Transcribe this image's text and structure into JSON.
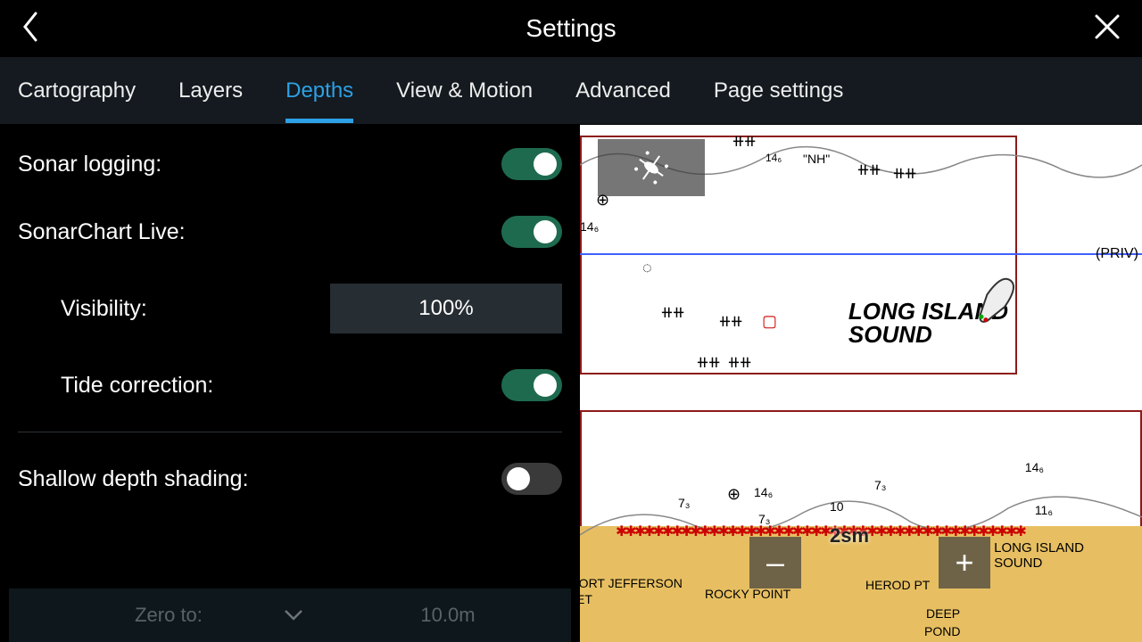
{
  "header": {
    "title": "Settings"
  },
  "tabs": [
    {
      "label": "Cartography",
      "active": false
    },
    {
      "label": "Layers",
      "active": false
    },
    {
      "label": "Depths",
      "active": true
    },
    {
      "label": "View & Motion",
      "active": false
    },
    {
      "label": "Advanced",
      "active": false
    },
    {
      "label": "Page settings",
      "active": false
    }
  ],
  "settings": {
    "sonar_logging_label": "Sonar logging:",
    "sonar_logging_on": true,
    "sonarchart_live_label": "SonarChart Live:",
    "sonarchart_live_on": true,
    "visibility_label": "Visibility:",
    "visibility_value": "100%",
    "tide_correction_label": "Tide correction:",
    "tide_correction_on": true,
    "shallow_depth_label": "Shallow depth shading:",
    "shallow_depth_on": false,
    "zero_to_label": "Zero to:",
    "zero_to_value": "10.0m"
  },
  "chart": {
    "region_label_line1": "LONG ISLAND",
    "region_label_line2": "SOUND",
    "region_label2": "LONG ISLAND",
    "region_label2b": "SOUND",
    "priv_label": "(PRIV)",
    "scale_label": "2sm",
    "place_rocky": "ROCKY POINT",
    "place_herod": "HEROD PT",
    "place_deep": "DEEP",
    "place_pond": "POND",
    "place_jeff1": "'ORT JEFFERSON",
    "place_jeff2": "ET",
    "nh_label": "\"NH\"",
    "depth_146a": "14₆",
    "depth_146b": "14₆",
    "depth_146c": "14₆",
    "depth_146d": "14₆",
    "depth_73a": "7₃",
    "depth_73b": "7₃",
    "depth_73c": "7₃",
    "depth_10": "10",
    "depth_116": "11₆"
  }
}
